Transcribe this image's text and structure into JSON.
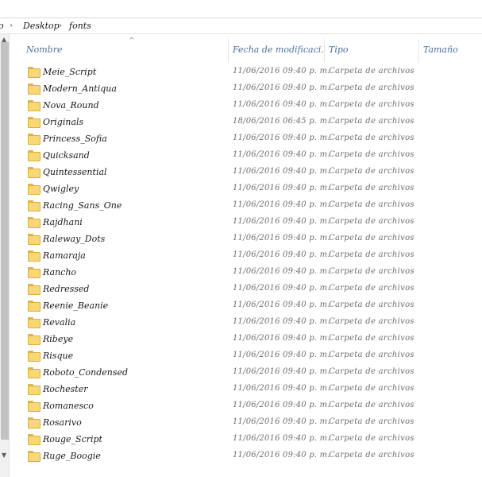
{
  "breadcrumb": {
    "items": [
      "o",
      "Desktop",
      "fonts"
    ]
  },
  "columns": {
    "name": "Nombre",
    "date": "Fecha de modificaci...",
    "type": "Tipo",
    "size": "Tamaño"
  },
  "colors": {
    "folder_fill": "#f8d775",
    "folder_border": "#dcae3e",
    "header_text": "#4a6f98"
  },
  "rows": [
    {
      "name": "Meie_Script",
      "date": "11/06/2016 09:40 p. m.",
      "type": "Carpeta de archivos"
    },
    {
      "name": "Modern_Antiqua",
      "date": "11/06/2016 09:40 p. m.",
      "type": "Carpeta de archivos"
    },
    {
      "name": "Nova_Round",
      "date": "11/06/2016 09:40 p. m.",
      "type": "Carpeta de archivos"
    },
    {
      "name": "Originals",
      "date": "18/06/2016 06:45 p. m.",
      "type": "Carpeta de archivos"
    },
    {
      "name": "Princess_Sofia",
      "date": "11/06/2016 09:40 p. m.",
      "type": "Carpeta de archivos"
    },
    {
      "name": "Quicksand",
      "date": "11/06/2016 09:40 p. m.",
      "type": "Carpeta de archivos"
    },
    {
      "name": "Quintessential",
      "date": "11/06/2016 09:40 p. m.",
      "type": "Carpeta de archivos"
    },
    {
      "name": "Qwigley",
      "date": "11/06/2016 09:40 p. m.",
      "type": "Carpeta de archivos"
    },
    {
      "name": "Racing_Sans_One",
      "date": "11/06/2016 09:40 p. m.",
      "type": "Carpeta de archivos"
    },
    {
      "name": "Rajdhani",
      "date": "11/06/2016 09:40 p. m.",
      "type": "Carpeta de archivos"
    },
    {
      "name": "Raleway_Dots",
      "date": "11/06/2016 09:40 p. m.",
      "type": "Carpeta de archivos"
    },
    {
      "name": "Ramaraja",
      "date": "11/06/2016 09:40 p. m.",
      "type": "Carpeta de archivos"
    },
    {
      "name": "Rancho",
      "date": "11/06/2016 09:40 p. m.",
      "type": "Carpeta de archivos"
    },
    {
      "name": "Redressed",
      "date": "11/06/2016 09:40 p. m.",
      "type": "Carpeta de archivos"
    },
    {
      "name": "Reenie_Beanie",
      "date": "11/06/2016 09:40 p. m.",
      "type": "Carpeta de archivos"
    },
    {
      "name": "Revalia",
      "date": "11/06/2016 09:40 p. m.",
      "type": "Carpeta de archivos"
    },
    {
      "name": "Ribeye",
      "date": "11/06/2016 09:40 p. m.",
      "type": "Carpeta de archivos"
    },
    {
      "name": "Risque",
      "date": "11/06/2016 09:40 p. m.",
      "type": "Carpeta de archivos"
    },
    {
      "name": "Roboto_Condensed",
      "date": "11/06/2016 09:40 p. m.",
      "type": "Carpeta de archivos"
    },
    {
      "name": "Rochester",
      "date": "11/06/2016 09:40 p. m.",
      "type": "Carpeta de archivos"
    },
    {
      "name": "Romanesco",
      "date": "11/06/2016 09:40 p. m.",
      "type": "Carpeta de archivos"
    },
    {
      "name": "Rosarivo",
      "date": "11/06/2016 09:40 p. m.",
      "type": "Carpeta de archivos"
    },
    {
      "name": "Rouge_Script",
      "date": "11/06/2016 09:40 p. m.",
      "type": "Carpeta de archivos"
    },
    {
      "name": "Ruge_Boogie",
      "date": "11/06/2016 09:40 p. m.",
      "type": "Carpeta de archivos"
    }
  ]
}
